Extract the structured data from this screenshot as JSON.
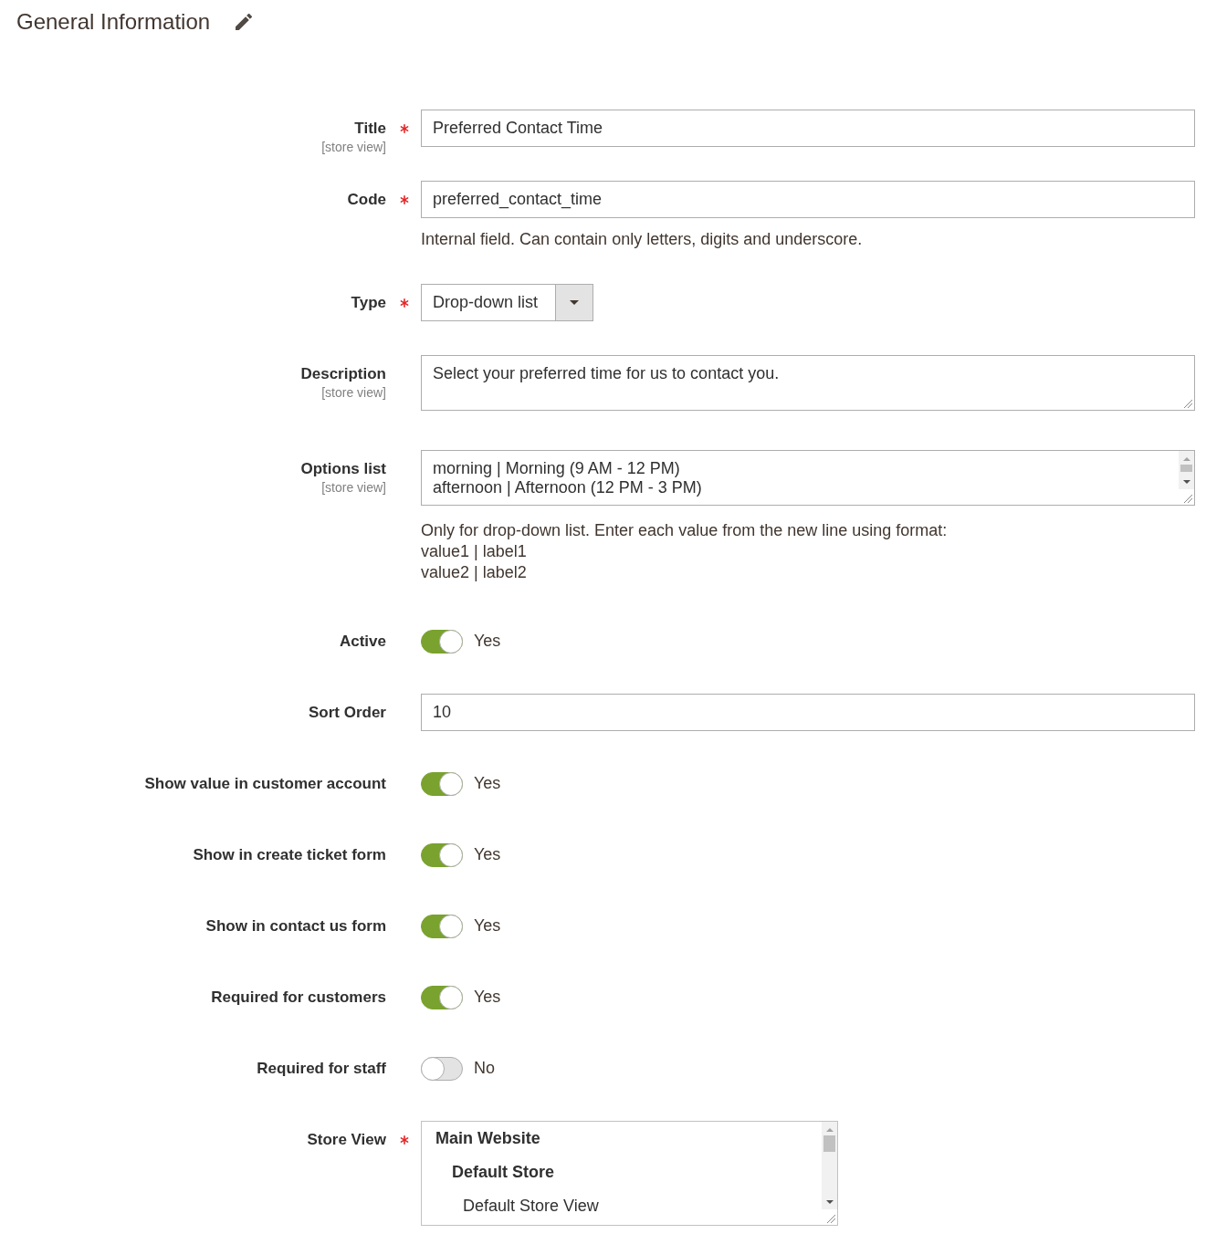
{
  "section": {
    "title": "General Information"
  },
  "fields": [
    {
      "kind": "text",
      "label": "Title",
      "scope": "[store view]",
      "required": true,
      "value": "Preferred Contact Time"
    },
    {
      "kind": "text",
      "label": "Code",
      "required": true,
      "value": "preferred_contact_time",
      "note": [
        "Internal field. Can contain only letters, digits and underscore."
      ]
    },
    {
      "kind": "select",
      "label": "Type",
      "required": true,
      "value": "Drop-down list"
    },
    {
      "kind": "textarea",
      "label": "Description",
      "scope": "[store view]",
      "required": false,
      "lines": [
        "Select your preferred time for us to contact you."
      ]
    },
    {
      "kind": "textarea",
      "label": "Options list",
      "scope": "[store view]",
      "required": false,
      "lines": [
        "morning | Morning (9 AM - 12 PM)",
        "afternoon | Afternoon (12 PM - 3 PM)"
      ],
      "scrollbar": true,
      "note": [
        "Only for drop-down list. Enter each value from the new line using format:",
        "value1 | label1",
        "value2 | label2"
      ]
    },
    {
      "kind": "toggle",
      "label": "Active",
      "required": false,
      "on": true,
      "state_label": "Yes"
    },
    {
      "kind": "text",
      "label": "Sort Order",
      "required": false,
      "value": "10"
    },
    {
      "kind": "toggle",
      "label": "Show value in customer account",
      "required": false,
      "on": true,
      "state_label": "Yes"
    },
    {
      "kind": "toggle",
      "label": "Show in create ticket form",
      "required": false,
      "on": true,
      "state_label": "Yes"
    },
    {
      "kind": "toggle",
      "label": "Show in contact us form",
      "required": false,
      "on": true,
      "state_label": "Yes"
    },
    {
      "kind": "toggle",
      "label": "Required for customers",
      "required": false,
      "on": true,
      "state_label": "Yes"
    },
    {
      "kind": "toggle",
      "label": "Required for staff",
      "required": false,
      "on": false,
      "state_label": "No"
    },
    {
      "kind": "multiselect",
      "label": "Store View",
      "required": true,
      "options": [
        {
          "kind": "group",
          "label": "Main Website",
          "children": [
            {
              "kind": "group",
              "label": "Default Store",
              "children": [
                {
                  "kind": "option",
                  "label": "Default Store View",
                  "selected": false
                }
              ]
            }
          ]
        }
      ]
    }
  ]
}
